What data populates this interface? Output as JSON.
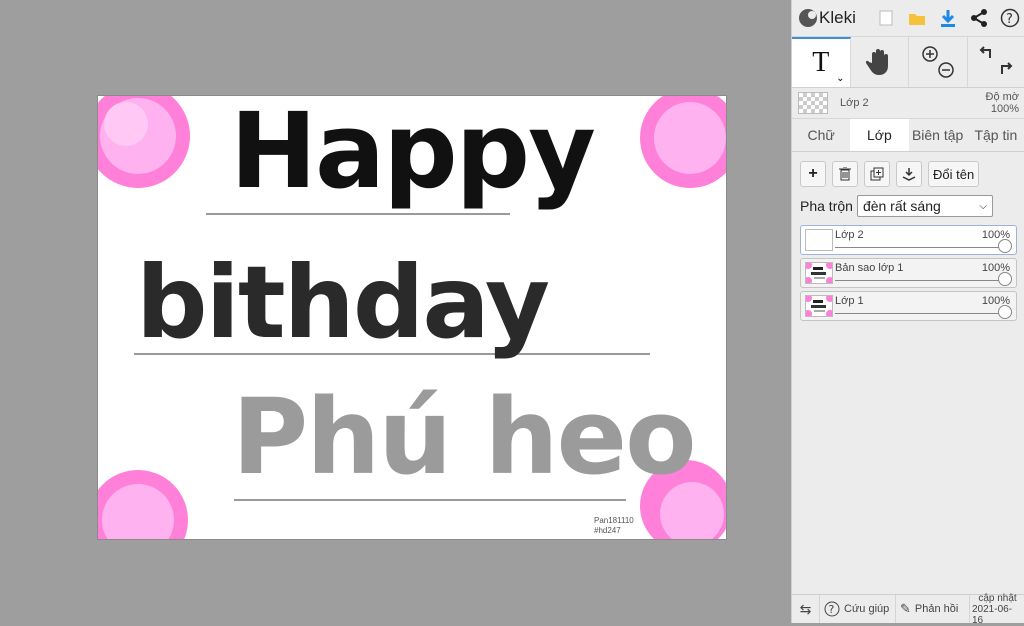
{
  "app": {
    "name": "Kleki"
  },
  "canvas": {
    "happy": "Happy",
    "birthday": "bithday",
    "name": "Phú heo",
    "watermark_line1": "Pan181110",
    "watermark_line2": "#hd247"
  },
  "toolbar_icons": [
    "new-icon",
    "open-icon",
    "download-icon",
    "share-icon",
    "help-icon"
  ],
  "layer_info": {
    "name": "Lớp 2",
    "opacity_label": "Độ mờ",
    "opacity_value": "100%"
  },
  "tabs": {
    "text": "Chữ",
    "layer": "Lớp",
    "edit": "Biên tập",
    "file": "Tập tin"
  },
  "actions": {
    "rename": "Đổi tên"
  },
  "blend": {
    "label": "Pha trộn",
    "value": "đèn rất sáng"
  },
  "layers": [
    {
      "name": "Lớp 2",
      "opacity": "100%"
    },
    {
      "name": "Bản sao lớp 1",
      "opacity": "100%"
    },
    {
      "name": "Lớp 1",
      "opacity": "100%"
    }
  ],
  "footer": {
    "help": "Cứu giúp",
    "feedback": "Phản hồi",
    "update": "cập nhật",
    "date": "2021-06-16"
  },
  "colors": {
    "accent": "#3a8fd6",
    "pink": "#ff7fd0",
    "pinkLight": "#ffb3ee"
  }
}
